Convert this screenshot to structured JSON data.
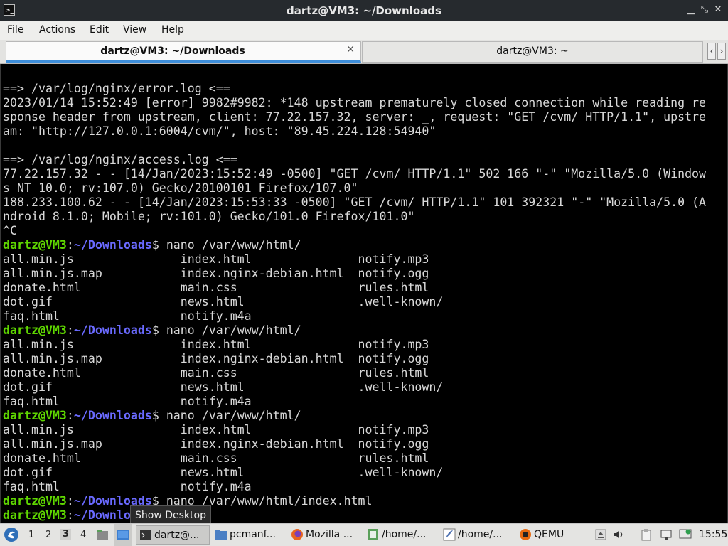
{
  "window": {
    "title": "dartz@VM3: ~/Downloads",
    "app_icon": "terminal-icon",
    "controls": [
      "minimize-icon",
      "maximize-icon",
      "close-icon"
    ]
  },
  "menu": [
    "File",
    "Actions",
    "Edit",
    "View",
    "Help"
  ],
  "tabs": [
    {
      "label": "dartz@VM3: ~/Downloads",
      "active": true
    },
    {
      "label": "dartz@VM3: ~",
      "active": false
    }
  ],
  "prompt": {
    "user": "dartz@VM3",
    "sep": ":",
    "path": "~/Downloads",
    "sym": "$"
  },
  "terminal_lines": [
    {
      "t": "text",
      "v": "==> /var/log/nginx/error.log <=="
    },
    {
      "t": "text",
      "v": "2023/01/14 15:52:49 [error] 9982#9982: *148 upstream prematurely closed connection while reading re"
    },
    {
      "t": "text",
      "v": "sponse header from upstream, client: 77.22.157.32, server: _, request: \"GET /cvm/ HTTP/1.1\", upstre"
    },
    {
      "t": "text",
      "v": "am: \"http://127.0.0.1:6004/cvm/\", host: \"89.45.224.128:54940\""
    },
    {
      "t": "text",
      "v": ""
    },
    {
      "t": "text",
      "v": "==> /var/log/nginx/access.log <=="
    },
    {
      "t": "text",
      "v": "77.22.157.32 - - [14/Jan/2023:15:52:49 -0500] \"GET /cvm/ HTTP/1.1\" 502 166 \"-\" \"Mozilla/5.0 (Window"
    },
    {
      "t": "text",
      "v": "s NT 10.0; rv:107.0) Gecko/20100101 Firefox/107.0\""
    },
    {
      "t": "text",
      "v": "188.233.100.62 - - [14/Jan/2023:15:53:33 -0500] \"GET /cvm/ HTTP/1.1\" 101 392321 \"-\" \"Mozilla/5.0 (A"
    },
    {
      "t": "text",
      "v": "ndroid 8.1.0; Mobile; rv:101.0) Gecko/101.0 Firefox/101.0\""
    },
    {
      "t": "text",
      "v": "^C"
    },
    {
      "t": "prompt",
      "v": " nano /var/www/html/"
    },
    {
      "t": "text",
      "v": "all.min.js               index.html               notify.mp3"
    },
    {
      "t": "text",
      "v": "all.min.js.map           index.nginx-debian.html  notify.ogg"
    },
    {
      "t": "text",
      "v": "donate.html              main.css                 rules.html"
    },
    {
      "t": "text",
      "v": "dot.gif                  news.html                .well-known/"
    },
    {
      "t": "text",
      "v": "faq.html                 notify.m4a"
    },
    {
      "t": "prompt",
      "v": " nano /var/www/html/"
    },
    {
      "t": "text",
      "v": "all.min.js               index.html               notify.mp3"
    },
    {
      "t": "text",
      "v": "all.min.js.map           index.nginx-debian.html  notify.ogg"
    },
    {
      "t": "text",
      "v": "donate.html              main.css                 rules.html"
    },
    {
      "t": "text",
      "v": "dot.gif                  news.html                .well-known/"
    },
    {
      "t": "text",
      "v": "faq.html                 notify.m4a"
    },
    {
      "t": "prompt",
      "v": " nano /var/www/html/"
    },
    {
      "t": "text",
      "v": "all.min.js               index.html               notify.mp3"
    },
    {
      "t": "text",
      "v": "all.min.js.map           index.nginx-debian.html  notify.ogg"
    },
    {
      "t": "text",
      "v": "donate.html              main.css                 rules.html"
    },
    {
      "t": "text",
      "v": "dot.gif                  news.html                .well-known/"
    },
    {
      "t": "text",
      "v": "faq.html                 notify.m4a"
    },
    {
      "t": "prompt",
      "v": " nano /var/www/html/index.html"
    },
    {
      "t": "prompt",
      "v": " ",
      "cursor": true
    }
  ],
  "tooltip": "Show Desktop",
  "taskbar": {
    "start_icon": "start-menu-icon",
    "workspaces": [
      "1",
      "2",
      "3",
      "4"
    ],
    "active_workspace": "3",
    "launchers": [
      "file-manager-icon",
      "show-desktop-icon"
    ],
    "tasks": [
      {
        "label": "dartz@...",
        "icon": "terminal-icon",
        "active": true
      },
      {
        "label": "pcmanf...",
        "icon": "folder-icon",
        "active": false
      },
      {
        "label": "Mozilla ...",
        "icon": "firefox-icon",
        "active": false
      },
      {
        "label": "/home/...",
        "icon": "text-editor-icon",
        "active": false
      },
      {
        "label": "/home/...",
        "icon": "feather-editor-icon",
        "active": false
      },
      {
        "label": "QEMU",
        "icon": "qemu-icon",
        "active": false
      }
    ],
    "tray": [
      "eject-icon",
      "volume-icon",
      "clipboard-icon",
      "network-icon",
      "update-icon"
    ],
    "clock": "15:55"
  },
  "colors": {
    "terminal_bg": "#000000",
    "terminal_fg": "#d8d8d8",
    "prompt_user": "#5fd700",
    "prompt_path": "#6a6aff",
    "tab_accent": "#3d8dd9"
  }
}
